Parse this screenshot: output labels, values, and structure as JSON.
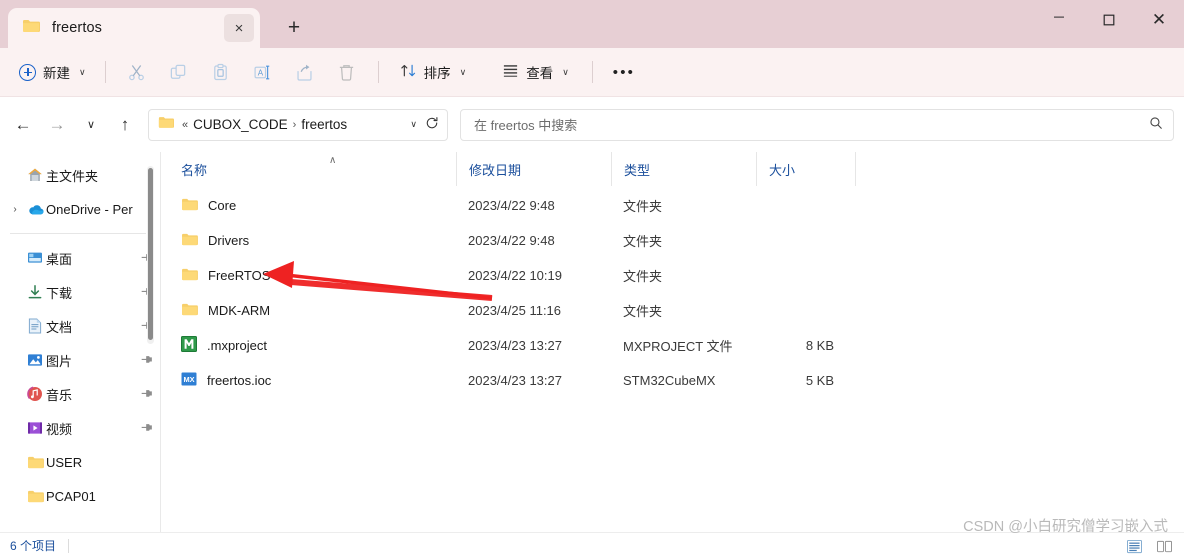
{
  "window": {
    "tab_title": "freertos",
    "tab_close_label": "×",
    "new_tab_label": "+",
    "minimize_label": "—",
    "maximize_label": "□",
    "close_label": "✕",
    "tabbar_color": "#e7cfd4",
    "tab_color": "#fbf2f2"
  },
  "toolbar": {
    "new_label": "新建",
    "new_chevron": "∨",
    "sort_label": "排序",
    "sort_chevron": "∨",
    "view_label": "查看",
    "view_chevron": "∨",
    "more_label": "•••",
    "icons": [
      {
        "name": "cut-icon",
        "title": "剪切"
      },
      {
        "name": "copy-icon",
        "title": "复制"
      },
      {
        "name": "paste-icon",
        "title": "粘贴"
      },
      {
        "name": "rename-icon",
        "title": "重命名"
      },
      {
        "name": "share-icon",
        "title": "共享"
      },
      {
        "name": "delete-icon",
        "title": "删除"
      }
    ]
  },
  "nav": {
    "back_label": "←",
    "forward_label": "→",
    "recent_label": "∨",
    "up_label": "↑",
    "breadcrumb": {
      "overflow": "«",
      "items": [
        "CUBOX_CODE",
        "freertos"
      ],
      "separator": "›",
      "chevron": "∨"
    },
    "refresh_label": "↻",
    "search_placeholder": "在 freertos 中搜索",
    "search_value": ""
  },
  "sidebar": {
    "items": [
      {
        "label": "主文件夹",
        "icon": "home-icon",
        "expander": "",
        "pinned": false
      },
      {
        "label": "OneDrive - Per",
        "icon": "onedrive-icon",
        "expander": "›",
        "pinned": false
      },
      {
        "separator": true
      },
      {
        "label": "桌面",
        "icon": "desktop-icon",
        "expander": "",
        "pinned": true
      },
      {
        "label": "下载",
        "icon": "downloads-icon",
        "expander": "",
        "pinned": true
      },
      {
        "label": "文档",
        "icon": "documents-icon",
        "expander": "",
        "pinned": true
      },
      {
        "label": "图片",
        "icon": "pictures-icon",
        "expander": "",
        "pinned": true
      },
      {
        "label": "音乐",
        "icon": "music-icon",
        "expander": "",
        "pinned": true
      },
      {
        "label": "视频",
        "icon": "videos-icon",
        "expander": "",
        "pinned": true
      },
      {
        "label": "USER",
        "icon": "folder-icon",
        "expander": "",
        "pinned": false
      },
      {
        "label": "PCAP01",
        "icon": "folder-icon",
        "expander": "",
        "pinned": false
      }
    ]
  },
  "filelist": {
    "columns": {
      "name": "名称",
      "date": "修改日期",
      "type": "类型",
      "size": "大小"
    },
    "sort_indicator": "∧",
    "rows": [
      {
        "name": "Core",
        "date": "2023/4/22 9:48",
        "type": "文件夹",
        "size": "",
        "icon": "folder-icon"
      },
      {
        "name": "Drivers",
        "date": "2023/4/22 9:48",
        "type": "文件夹",
        "size": "",
        "icon": "folder-icon"
      },
      {
        "name": "FreeRTOS",
        "date": "2023/4/22 10:19",
        "type": "文件夹",
        "size": "",
        "icon": "folder-icon"
      },
      {
        "name": "MDK-ARM",
        "date": "2023/4/25 11:16",
        "type": "文件夹",
        "size": "",
        "icon": "folder-icon"
      },
      {
        "name": ".mxproject",
        "date": "2023/4/23 13:27",
        "type": "MXPROJECT 文件",
        "size": "8 KB",
        "icon": "mxproject-file-icon"
      },
      {
        "name": "freertos.ioc",
        "date": "2023/4/23 13:27",
        "type": "STM32CubeMX",
        "size": "5 KB",
        "icon": "ioc-file-icon"
      }
    ]
  },
  "status": {
    "item_count": "6 个项目"
  },
  "annotation": {
    "arrow_color": "#ee2222",
    "arrow_target": "FreeRTOS"
  },
  "watermark": {
    "text": "CSDN @小白研究僧学习嵌入式"
  }
}
